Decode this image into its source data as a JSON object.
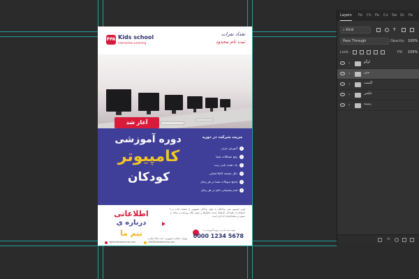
{
  "document": {
    "logo": {
      "mark": "PPA",
      "title": "Kids school",
      "subtitle": "interactive Learning"
    },
    "header": {
      "line1": "تعداد نفرات",
      "line2": "ثبت نام محدود"
    },
    "badge": "آغاز شد",
    "headline": {
      "course": "دوره آموزشی",
      "computer": "کامپیوتر",
      "kids": "کودکان"
    },
    "features_title": "مزیت شرکت در دوره",
    "features": [
      "آموزش جزئی",
      "رفع مشکلات شما",
      "یاد دهنده تایپ زنده",
      "حال چشمه کاملا فجایی",
      "پاسخ سوالات شما در هر زمان",
      "قدم پشتیبانی دائم در هر زمان"
    ],
    "info": {
      "line1": "اطلاعاتی",
      "line2": "درباره ی",
      "line3": "تیم ما"
    },
    "paragraph": "لورم ایپسوم متن ساختگی با تولید سادگی نامفهوم از صنعت چاپ و با استفاده از طراحان گرافیک است چاپگرها و متون بلکه روزنامه و مجله در ستون و سطرآنچنان که لازم است",
    "phone_label": "جهت ثبت نام در دوره آموزشی با",
    "phone": "0000 1234 5678",
    "address": "تهران، خیابان جمهوری، جنب بانک تجارت",
    "website": "www.kidslearning.com",
    "email": "info@kidslearning.com"
  },
  "panel": {
    "tabs": [
      "Layers",
      "Pa",
      "Ch",
      "Pa",
      "Co",
      "Sw",
      "Gr",
      "Pa"
    ],
    "filter_kind": "Kind",
    "blend_mode": "Pass Through",
    "opacity_label": "Opacity:",
    "opacity_value": "100%",
    "lock_label": "Lock:",
    "fill_label": "Fill:",
    "fill_value": "100%",
    "layers": [
      {
        "name": "لوگو",
        "selected": false
      },
      {
        "name": "متن",
        "selected": true
      },
      {
        "name": "المنت",
        "selected": false
      },
      {
        "name": "عکس",
        "selected": false
      },
      {
        "name": "زمینه",
        "selected": false
      }
    ],
    "footer_fx": "fx"
  },
  "colors": {
    "accent_red": "#d81b3b",
    "band_purple": "#3f3f9a",
    "highlight_yellow": "#f3c623",
    "guide_cyan": "#1ec8c8",
    "panel_bg": "#323232"
  }
}
